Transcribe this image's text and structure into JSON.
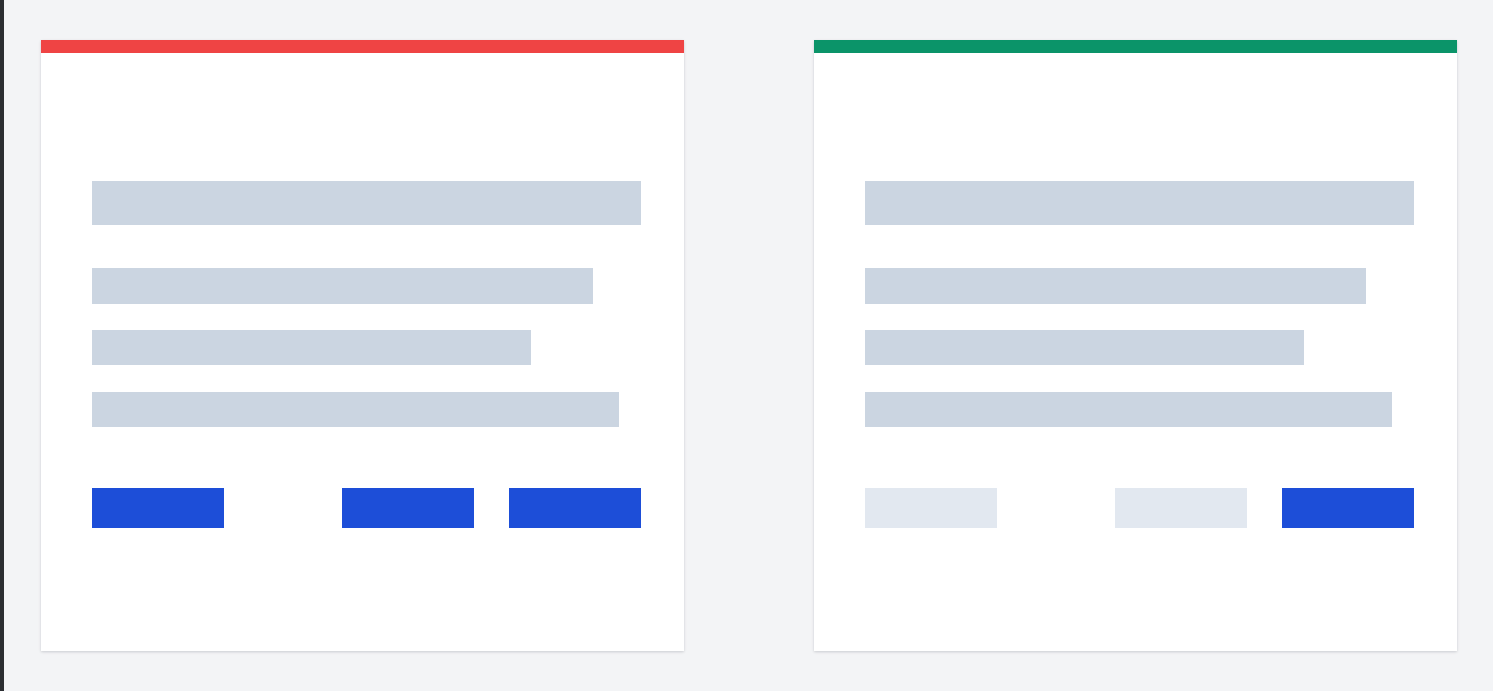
{
  "colors": {
    "background": "#f3f4f6",
    "card": "#ffffff",
    "placeholder_line": "#cbd5e1",
    "primary_button": "#1d4ed8",
    "secondary_button": "#e2e8f0"
  },
  "cards": [
    {
      "variant": "incorrect",
      "accent_color": "#ef4444",
      "text_lines": 4,
      "buttons": [
        {
          "style": "primary",
          "color": "#1d4ed8"
        },
        {
          "style": "primary",
          "color": "#1d4ed8"
        },
        {
          "style": "primary",
          "color": "#1d4ed8"
        }
      ]
    },
    {
      "variant": "correct",
      "accent_color": "#0b9469",
      "text_lines": 4,
      "buttons": [
        {
          "style": "secondary",
          "color": "#e2e8f0"
        },
        {
          "style": "secondary",
          "color": "#e2e8f0"
        },
        {
          "style": "primary",
          "color": "#1d4ed8"
        }
      ]
    }
  ]
}
